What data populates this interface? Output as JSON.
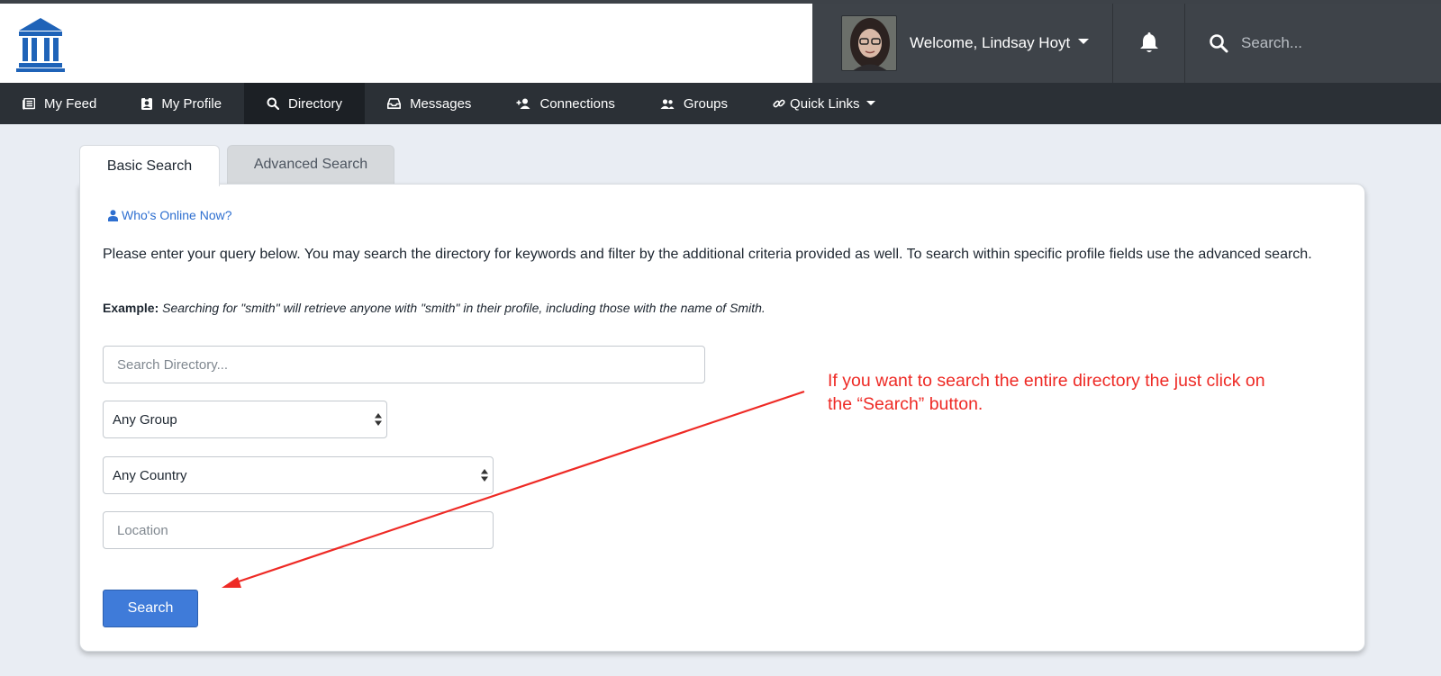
{
  "header": {
    "logo_icon": "institution-icon",
    "welcome_text": "Welcome, Lindsay Hoyt",
    "bell_icon": "bell-icon",
    "search_placeholder": "Search..."
  },
  "nav": {
    "items": [
      {
        "label": "My Feed",
        "icon": "newspaper-icon"
      },
      {
        "label": "My Profile",
        "icon": "id-badge-icon"
      },
      {
        "label": "Directory",
        "icon": "search-icon",
        "active": true
      },
      {
        "label": "Messages",
        "icon": "inbox-icon"
      },
      {
        "label": "Connections",
        "icon": "user-plus-icon"
      },
      {
        "label": "Groups",
        "icon": "users-icon"
      },
      {
        "label": "Quick Links",
        "icon": "link-icon",
        "dropdown": true
      }
    ]
  },
  "tabs": {
    "basic": "Basic Search",
    "advanced": "Advanced Search"
  },
  "content": {
    "online_link": "Who's Online Now?",
    "intro": "Please enter your query below. You may search the directory for keywords and filter by the additional criteria provided as well. To search within specific profile fields use the advanced search.",
    "example_label": "Example:",
    "example_text": "Searching for \"smith\" will retrieve anyone with \"smith\" in their profile, including those with the name of Smith."
  },
  "form": {
    "search_placeholder": "Search Directory...",
    "group_selected": "Any Group",
    "country_selected": "Any Country",
    "location_placeholder": "Location",
    "submit_label": "Search"
  },
  "annotation": {
    "text": "If you want to search the entire directory the just click on the “Search” button.",
    "color": "#ee2a25"
  },
  "colors": {
    "accent": "#3f7bd9",
    "link": "#2e6fd0",
    "nav_bg": "#2b3036",
    "header_dark": "#3e4349",
    "page_bg": "#e9edf3"
  }
}
